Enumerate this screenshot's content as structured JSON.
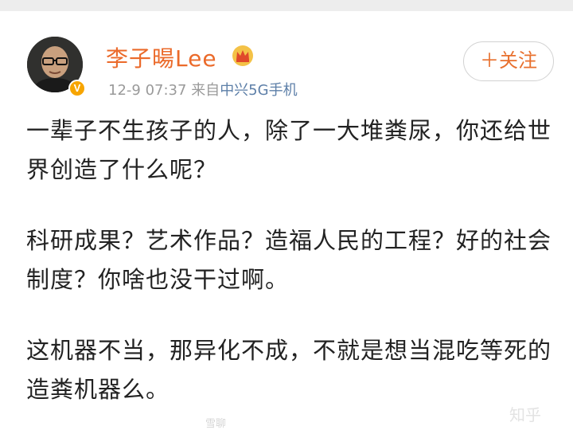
{
  "post": {
    "author": "李子暘Lee",
    "verified_badge": "V",
    "date": "12-9 07:37",
    "source_prefix": "来自",
    "source": "中兴5G手机",
    "follow_label": "＋关注",
    "paragraphs": [
      "一辈子不生孩子的人，除了一大堆粪尿，你还给世界创造了什么呢？",
      "科研成果？艺术作品？造福人民的工程？好的社会制度？你啥也没干过啊。",
      "这机器不当，那异化不成，不就是想当混吃等死的造粪机器么。"
    ]
  },
  "footer": {
    "zhihu_watermark": "知乎",
    "blurred_watermark": "雪聊"
  },
  "icons": {
    "crown": "crown-icon",
    "avatar": "avatar-photo"
  },
  "colors": {
    "author_name": "#eb6a2a",
    "follow_text": "#e8702e",
    "source_text": "#5d7fa8",
    "meta_text": "#9a9a9a",
    "badge": "#f7a500"
  }
}
